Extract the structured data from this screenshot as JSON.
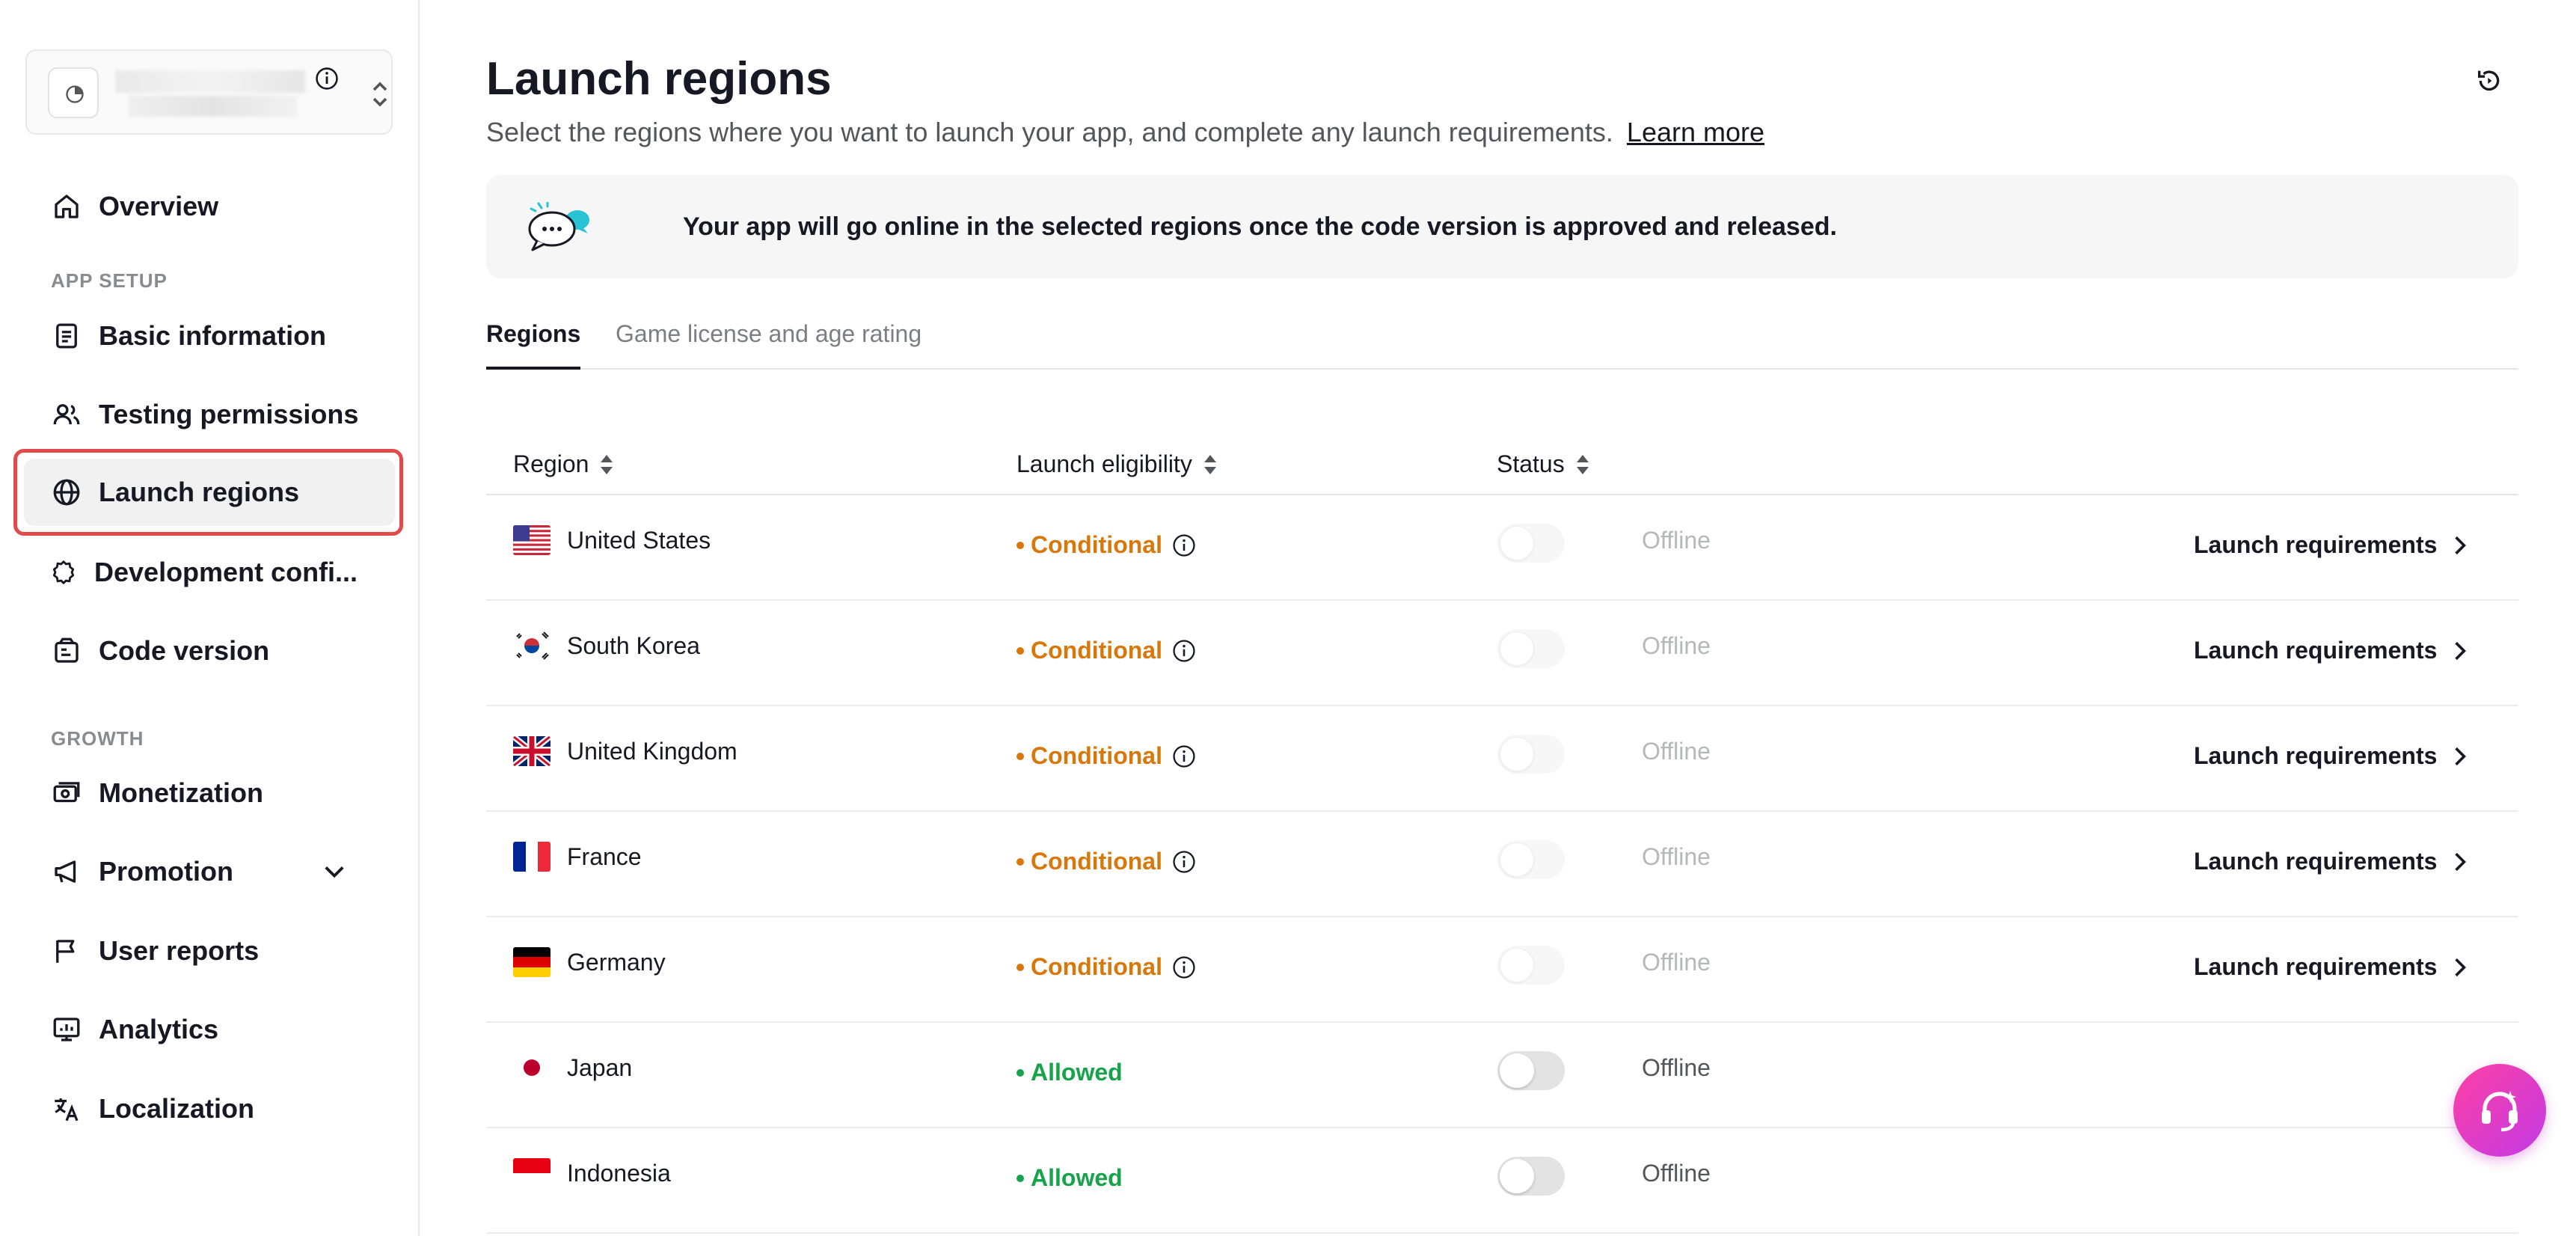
{
  "sidebar": {
    "app_switcher": {
      "icons": [
        "app-logo-icon",
        "info-icon",
        "sort-icon"
      ]
    },
    "overview": "Overview",
    "section_app_setup": "APP SETUP",
    "basic_information": "Basic information",
    "testing_permissions": "Testing permissions",
    "launch_regions": "Launch regions",
    "development_config": "Development confi...",
    "code_version": "Code version",
    "section_growth": "GROWTH",
    "monetization": "Monetization",
    "promotion": "Promotion",
    "user_reports": "User reports",
    "analytics": "Analytics",
    "localization": "Localization"
  },
  "header": {
    "title": "Launch regions",
    "subtitle": "Select the regions where you want to launch your app, and complete any launch requirements.",
    "learn_more": "Learn more"
  },
  "banner": {
    "text": "Your app will go online in the selected regions once the code version is approved and released."
  },
  "tabs": {
    "regions": "Regions",
    "game_license": "Game license and age rating"
  },
  "table": {
    "headers": {
      "region": "Region",
      "eligibility": "Launch eligibility",
      "status": "Status"
    },
    "rows": [
      {
        "region": "United States",
        "eligibility": "Conditional",
        "status": "Offline",
        "action": "Launch requirements"
      },
      {
        "region": "South Korea",
        "eligibility": "Conditional",
        "status": "Offline",
        "action": "Launch requirements"
      },
      {
        "region": "United Kingdom",
        "eligibility": "Conditional",
        "status": "Offline",
        "action": "Launch requirements"
      },
      {
        "region": "France",
        "eligibility": "Conditional",
        "status": "Offline",
        "action": "Launch requirements"
      },
      {
        "region": "Germany",
        "eligibility": "Conditional",
        "status": "Offline",
        "action": "Launch requirements"
      },
      {
        "region": "Japan",
        "eligibility": "Allowed",
        "status": "Offline"
      },
      {
        "region": "Indonesia",
        "eligibility": "Allowed",
        "status": "Offline"
      }
    ]
  },
  "colors": {
    "conditional": "#d9770a",
    "allowed": "#16a34a",
    "active_outline": "#e24a4a",
    "fab_gradient_start": "#ff3fa4",
    "fab_gradient_end": "#c23be6"
  }
}
